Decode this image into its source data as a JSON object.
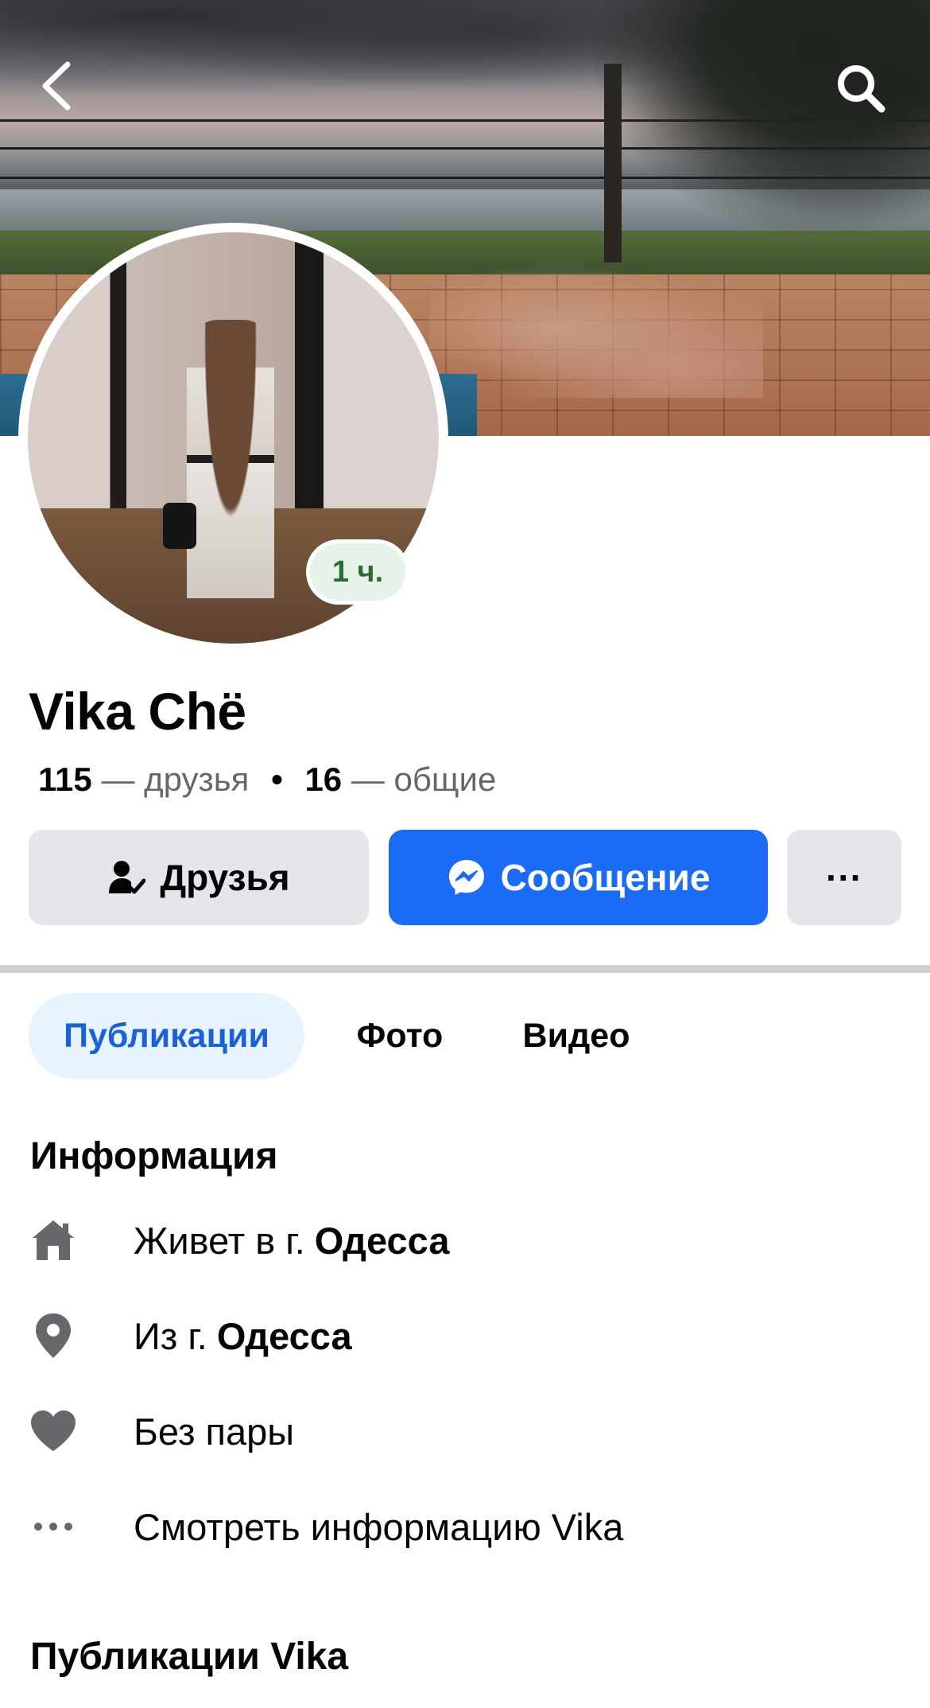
{
  "cover": {
    "description_icon": "cover-photo"
  },
  "nav": {
    "back_icon": "chevron-left-icon",
    "search_icon": "search-icon"
  },
  "profile": {
    "name": "Vika Chë",
    "story_age": "1 ч.",
    "friends_count": "115",
    "friends_label": "— друзья",
    "separator": "•",
    "mutual_count": "16",
    "mutual_label": "— общие"
  },
  "actions": {
    "friends_label": "Друзья",
    "message_label": "Сообщение",
    "more_label": "···"
  },
  "tabs": [
    {
      "label": "Публикации",
      "active": true
    },
    {
      "label": "Фото",
      "active": false
    },
    {
      "label": "Видео",
      "active": false
    }
  ],
  "info": {
    "title": "Информация",
    "rows": [
      {
        "icon": "home-icon",
        "prefix": "Живет в г.",
        "bold": "Одесса"
      },
      {
        "icon": "location-pin-icon",
        "prefix": "Из г.",
        "bold": "Одесса"
      },
      {
        "icon": "heart-icon",
        "prefix": "Без пары",
        "bold": ""
      },
      {
        "icon": "more-dots-icon",
        "prefix": "Смотреть информацию Vika",
        "bold": ""
      }
    ]
  },
  "posts_section": {
    "title": "Публикации Vika"
  },
  "colors": {
    "accent": "#1b6bf6",
    "tab_active_bg": "#e7f3ff",
    "tab_active_text": "#1b62d6",
    "button_grey": "#e4e6eb",
    "story_badge_bg": "#e7f3e8",
    "story_badge_text": "#2e6b34"
  }
}
